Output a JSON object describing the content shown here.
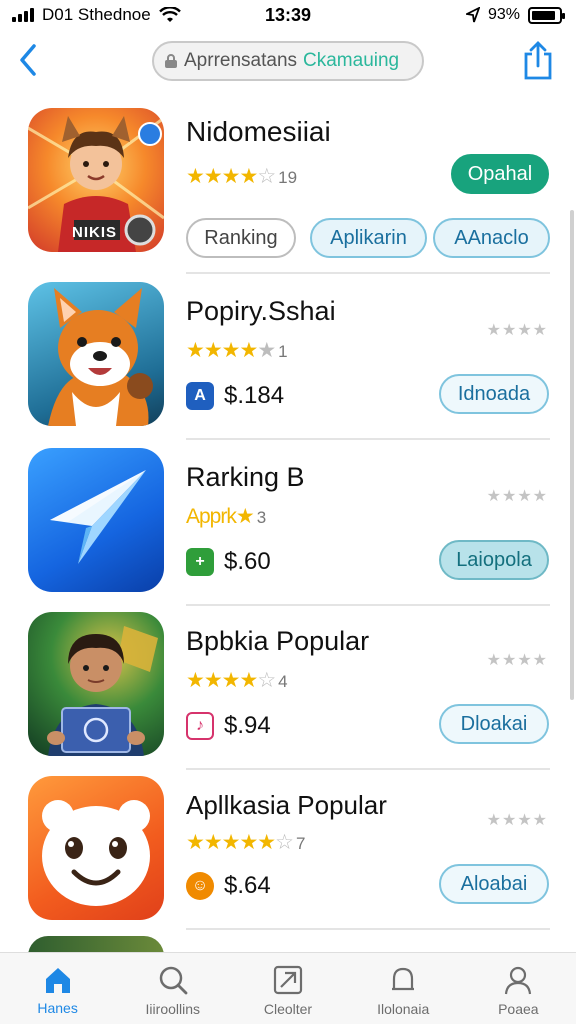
{
  "status_bar": {
    "carrier": "D01 Sthednoe",
    "time": "13:39",
    "battery": "93%",
    "battery_level": 0.9
  },
  "nav": {
    "search_text": "Aprrensatans",
    "search_accent": "Ckamauing"
  },
  "apps": [
    {
      "name": "Nidomesiiai",
      "rating_stars": "★★★★",
      "rating_empty": "☆",
      "rating_count": "19",
      "get_label": "Opahal",
      "chips": [
        "Ranking",
        "Aplikarin",
        "AAnaclo"
      ],
      "icon_name": "hero-game-icon",
      "badge": "NIKIS"
    },
    {
      "name": "Popiry.Sshai",
      "rating_stars": "★★★★",
      "rating_empty": "★",
      "rating_count": "1",
      "price": "$.184",
      "price_icon": "A",
      "price_icon_color": "#1f5fbf",
      "get_label": "Idnoada",
      "mini_stars": "★★★★",
      "icon_name": "fox-icon"
    },
    {
      "name": "Rarking B",
      "rating_text": "Apprk",
      "rating_stars": "★",
      "rating_count": "3",
      "price": "$.60",
      "price_icon": "+",
      "price_icon_color": "#2f9e3a",
      "get_label": "Laiopola",
      "mini_stars": "★★★★",
      "icon_name": "paper-plane-icon"
    },
    {
      "name": "Bpbkia Popular",
      "rating_stars": "★★★★",
      "rating_empty": "☆",
      "rating_count": "4",
      "price": "$.94",
      "price_icon": "♪",
      "price_icon_color": "#d6336c",
      "get_label": "Dloakai",
      "mini_stars": "★★★★",
      "icon_name": "boy-laptop-icon"
    },
    {
      "name": "Apllkasia Popular",
      "rating_stars": "★★★★★",
      "rating_empty": "☆",
      "rating_count": "7",
      "price": "$.64",
      "price_icon": "☺",
      "price_icon_color": "#f08a00",
      "get_label": "Aloabai",
      "mini_stars": "★★★★",
      "icon_name": "bear-face-icon"
    }
  ],
  "tabs": [
    {
      "label": "Hanes",
      "icon": "home-icon",
      "active": true
    },
    {
      "label": "Iiiroollins",
      "icon": "search-icon",
      "active": false
    },
    {
      "label": "Cleolter",
      "icon": "apps-icon",
      "active": false
    },
    {
      "label": "Ilolonaia",
      "icon": "bell-icon",
      "active": false
    },
    {
      "label": "Poaea",
      "icon": "person-icon",
      "active": false
    }
  ],
  "colors": {
    "accent": "#1e88e5",
    "star": "#f2b600",
    "green_button": "#18a37d"
  }
}
